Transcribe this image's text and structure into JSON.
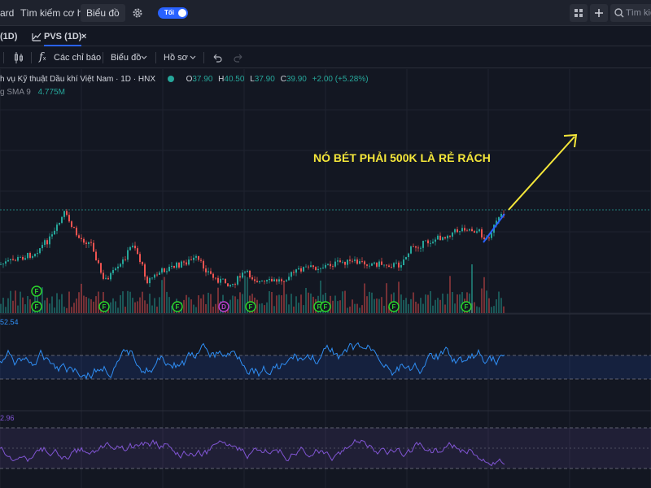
{
  "topbar": {
    "nav": [
      "ard",
      "Tìm kiếm cơ hội",
      "Biểu đồ"
    ],
    "theme_toggle": "Tối",
    "search_placeholder": "Tìm kiế"
  },
  "tabs": [
    "(1D)",
    "PVS (1D)"
  ],
  "tab_close": "×",
  "toolbar": {
    "indicators": "Các chỉ báo",
    "chart": "Biểu đồ",
    "profile": "Hồ sơ"
  },
  "legend": {
    "title": "h vụ Kỹ thuật Dầu khí Việt Nam · 1D · HNX",
    "open_label": "O",
    "open": "37.90",
    "high_label": "H",
    "high": "40.50",
    "low_label": "L",
    "low": "37.90",
    "close_label": "C",
    "close": "39.90",
    "change": "+2.00 (+5.28%)",
    "volume_label": "g SMA 9",
    "volume_value": "4.775M"
  },
  "indicators": {
    "ind1_value": "52.54",
    "ind2_value": "2.96"
  },
  "annotation": "NÓ BÉT PHẢI 500K LÀ RẺ RÁCH",
  "event_markers": {
    "markers": [
      "F",
      "F",
      "F",
      "F",
      "D",
      "F",
      "F",
      "F",
      "F",
      "F"
    ]
  },
  "colors": {
    "background": "#131722",
    "up": "#26a69a",
    "down": "#ef5350",
    "accent": "#2962ff",
    "annotation": "#f5e73a",
    "indicator1": "#2f8ef4",
    "indicator2": "#8155d4"
  },
  "chart_data": {
    "type": "candlestick",
    "symbol": "PVS",
    "interval": "1D",
    "exchange": "HNX",
    "last_ohlc": {
      "open": 37.9,
      "high": 40.5,
      "low": 37.9,
      "close": 39.9
    },
    "change": 2.0,
    "change_pct": 5.28,
    "volume_sma9": "4.775M",
    "indicator_values": [
      52.54,
      2.96
    ]
  }
}
